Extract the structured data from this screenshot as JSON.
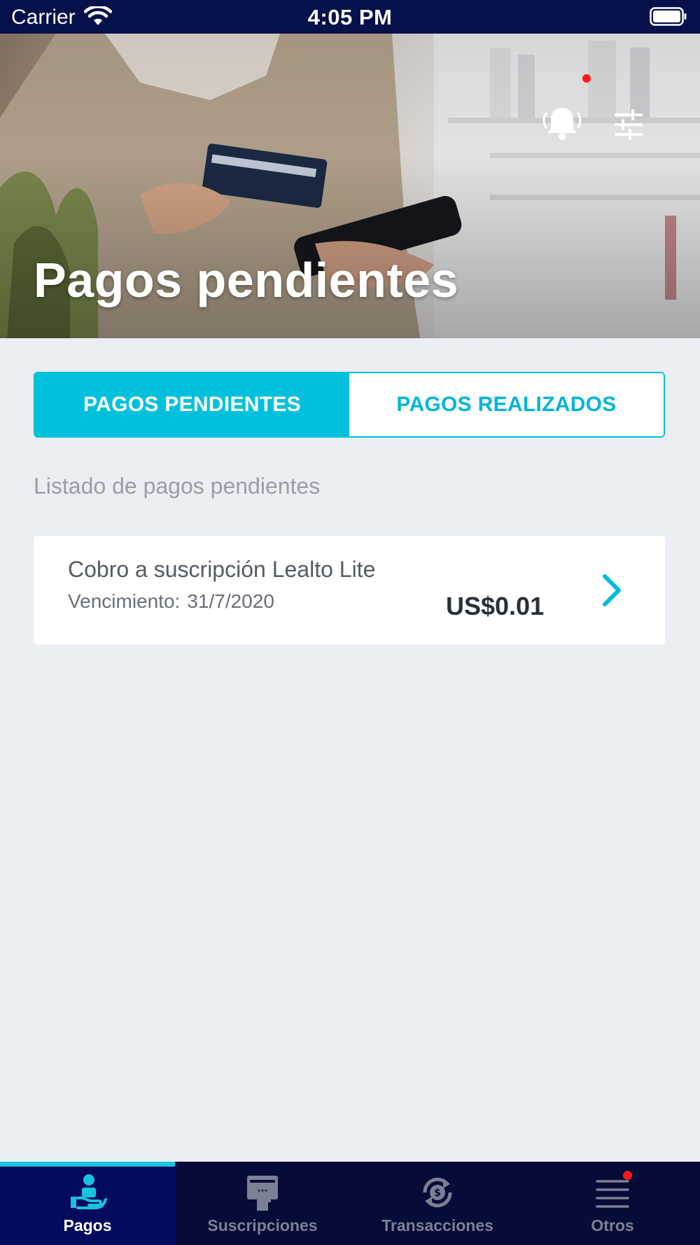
{
  "status_bar": {
    "carrier": "Carrier",
    "time": "4:05 PM"
  },
  "hero": {
    "title": "Pagos pendientes",
    "icons": [
      "notification-bell-icon",
      "filter-sliders-icon"
    ]
  },
  "tabs": [
    {
      "label": "PAGOS PENDIENTES",
      "active": true
    },
    {
      "label": "PAGOS REALIZADOS",
      "active": false
    }
  ],
  "list": {
    "heading": "Listado de pagos pendientes",
    "items": [
      {
        "title": "Cobro a suscripción Lealto Lite",
        "due_label": "Vencimiento:",
        "due_date": "31/7/2020",
        "amount": "US$0.01"
      }
    ]
  },
  "bottom_nav": [
    {
      "label": "Pagos",
      "icon": "hand-payment-icon",
      "active": true
    },
    {
      "label": "Suscripciones",
      "icon": "subscription-card-icon",
      "active": false
    },
    {
      "label": "Transacciones",
      "icon": "dollar-cycle-icon",
      "active": false
    },
    {
      "label": "Otros",
      "icon": "menu-lines-icon",
      "active": false,
      "has_notification": true
    }
  ],
  "colors": {
    "accent": "#00c0de",
    "nav_background": "#070b38",
    "status_bar": "#06104a",
    "page_background": "#ebeef2",
    "notification_dot": "#ff1a1a"
  }
}
